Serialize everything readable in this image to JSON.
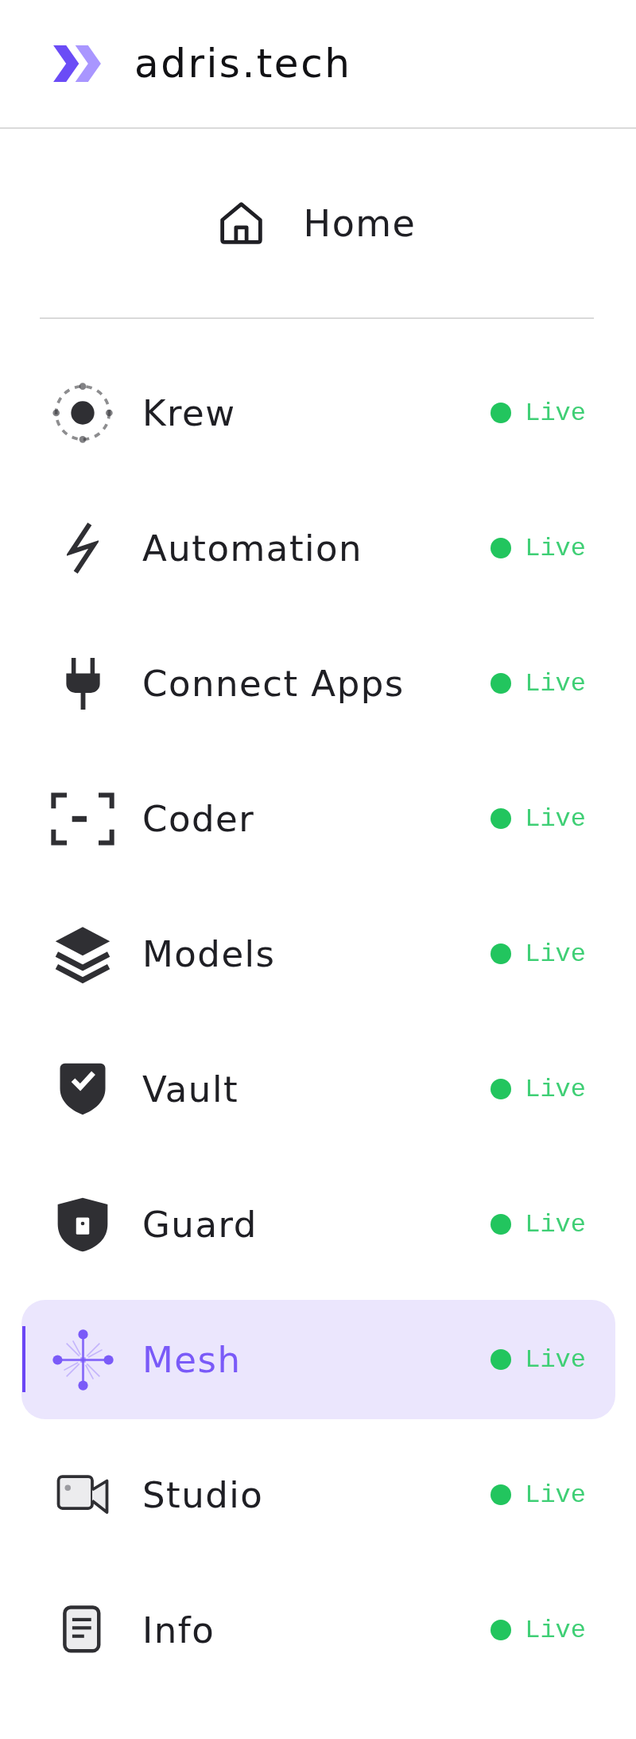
{
  "brand": {
    "name": "adris.tech"
  },
  "home": {
    "label": "Home"
  },
  "nav_items": [
    {
      "label": "Krew",
      "status": "Live",
      "selected": false
    },
    {
      "label": "Automation",
      "status": "Live",
      "selected": false
    },
    {
      "label": "Connect Apps",
      "status": "Live",
      "selected": false
    },
    {
      "label": "Coder",
      "status": "Live",
      "selected": false
    },
    {
      "label": "Models",
      "status": "Live",
      "selected": false
    },
    {
      "label": "Vault",
      "status": "Live",
      "selected": false
    },
    {
      "label": "Guard",
      "status": "Live",
      "selected": false
    },
    {
      "label": "Mesh",
      "status": "Live",
      "selected": true
    },
    {
      "label": "Studio",
      "status": "Live",
      "selected": false
    },
    {
      "label": "Info",
      "status": "Live",
      "selected": false
    }
  ]
}
